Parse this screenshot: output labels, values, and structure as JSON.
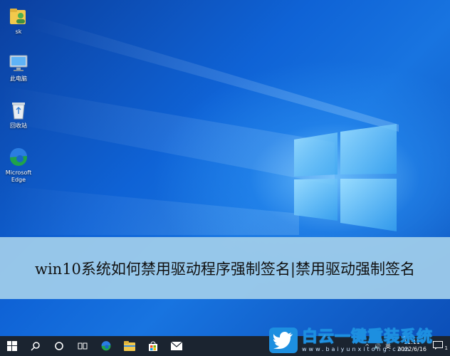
{
  "desktop": {
    "icons": [
      {
        "label": "sk",
        "icon": "user-folder-icon"
      },
      {
        "label": "此电脑",
        "icon": "this-pc-icon"
      },
      {
        "label": "回收站",
        "icon": "recycle-bin-icon"
      },
      {
        "label": "Microsoft Edge",
        "icon": "edge-icon"
      }
    ]
  },
  "banner": {
    "title": "win10系统如何禁用驱动程序强制签名|禁用驱动强制签名"
  },
  "taskbar": {
    "buttons": [
      {
        "name": "start",
        "icon": "windows-start-icon"
      },
      {
        "name": "search",
        "icon": "search-icon"
      },
      {
        "name": "cortana",
        "icon": "cortana-circle-icon"
      },
      {
        "name": "task-view",
        "icon": "task-view-icon"
      },
      {
        "name": "edge",
        "icon": "edge-icon"
      },
      {
        "name": "file-explorer",
        "icon": "folder-icon"
      },
      {
        "name": "store",
        "icon": "store-bag-icon"
      },
      {
        "name": "mail",
        "icon": "mail-icon"
      }
    ],
    "tray": {
      "chevron": "^",
      "volume": "🔊",
      "ime": "英",
      "time": "11:11",
      "date": "2022/6/16",
      "notification_count": "1"
    }
  },
  "watermark": {
    "title": "白云一键重装系统",
    "url": "www.baiyunxitong.com"
  },
  "colors": {
    "taskbar": "#1b2430",
    "banner": "#a0cdeb",
    "accent": "#1d8fe0"
  }
}
